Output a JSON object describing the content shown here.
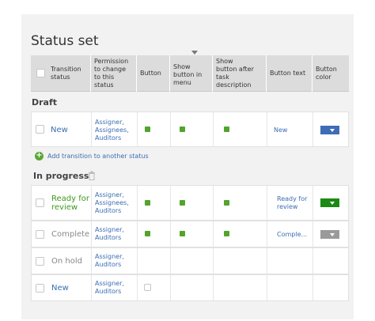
{
  "title": "Status set",
  "header": {
    "transition_status": "Transition\nstatus",
    "permission": "Permission\nto change\nto this\nstatus",
    "button": "Button",
    "show_in_menu": "Show\nbutton in\nmenu",
    "show_after_task": "Show\nbutton after\ntask\ndescription",
    "button_text": "Button text",
    "button_color": "Button\ncolor"
  },
  "sections": {
    "draft": {
      "title": "Draft"
    },
    "in_progress": {
      "title": "In progress"
    }
  },
  "add_transition_label": "Add transition to another status",
  "rows": [
    {
      "status": "New",
      "status_color": "#3b6db3",
      "permission": "Assigner,\nAssignees,\nAuditors",
      "button": true,
      "show_in_menu": true,
      "show_after_task": true,
      "button_text": "New",
      "button_color": "#3d6db5"
    },
    {
      "status": "Ready for\nreview",
      "status_color": "#3c9a1e",
      "permission": "Assigner,\nAssignees,\nAuditors",
      "button": true,
      "show_in_menu": true,
      "show_after_task": true,
      "button_text": "Ready for\nreview",
      "button_color": "#1b8a12"
    },
    {
      "status": "Complete",
      "status_color": "#888888",
      "permission": "Assigner,\nAuditors",
      "button": true,
      "show_in_menu": true,
      "show_after_task": true,
      "button_text": "Comple...",
      "button_color": "#9a9a9a"
    },
    {
      "status": "On hold",
      "status_color": "#888888",
      "permission": "Assigner,\nAuditors",
      "button": false,
      "show_in_menu": false,
      "show_after_task": false,
      "button_text": "",
      "button_color": ""
    },
    {
      "status": "New",
      "status_color": "#3b6db3",
      "permission": "Assigner,\nAuditors",
      "button": false,
      "show_in_menu": false,
      "show_after_task": false,
      "button_text": "",
      "button_color": ""
    }
  ],
  "icons": {
    "collapse": "chevron-down-icon",
    "trash": "trash-icon",
    "add": "plus-circle-icon",
    "color_dropdown": "caret-down-icon"
  }
}
